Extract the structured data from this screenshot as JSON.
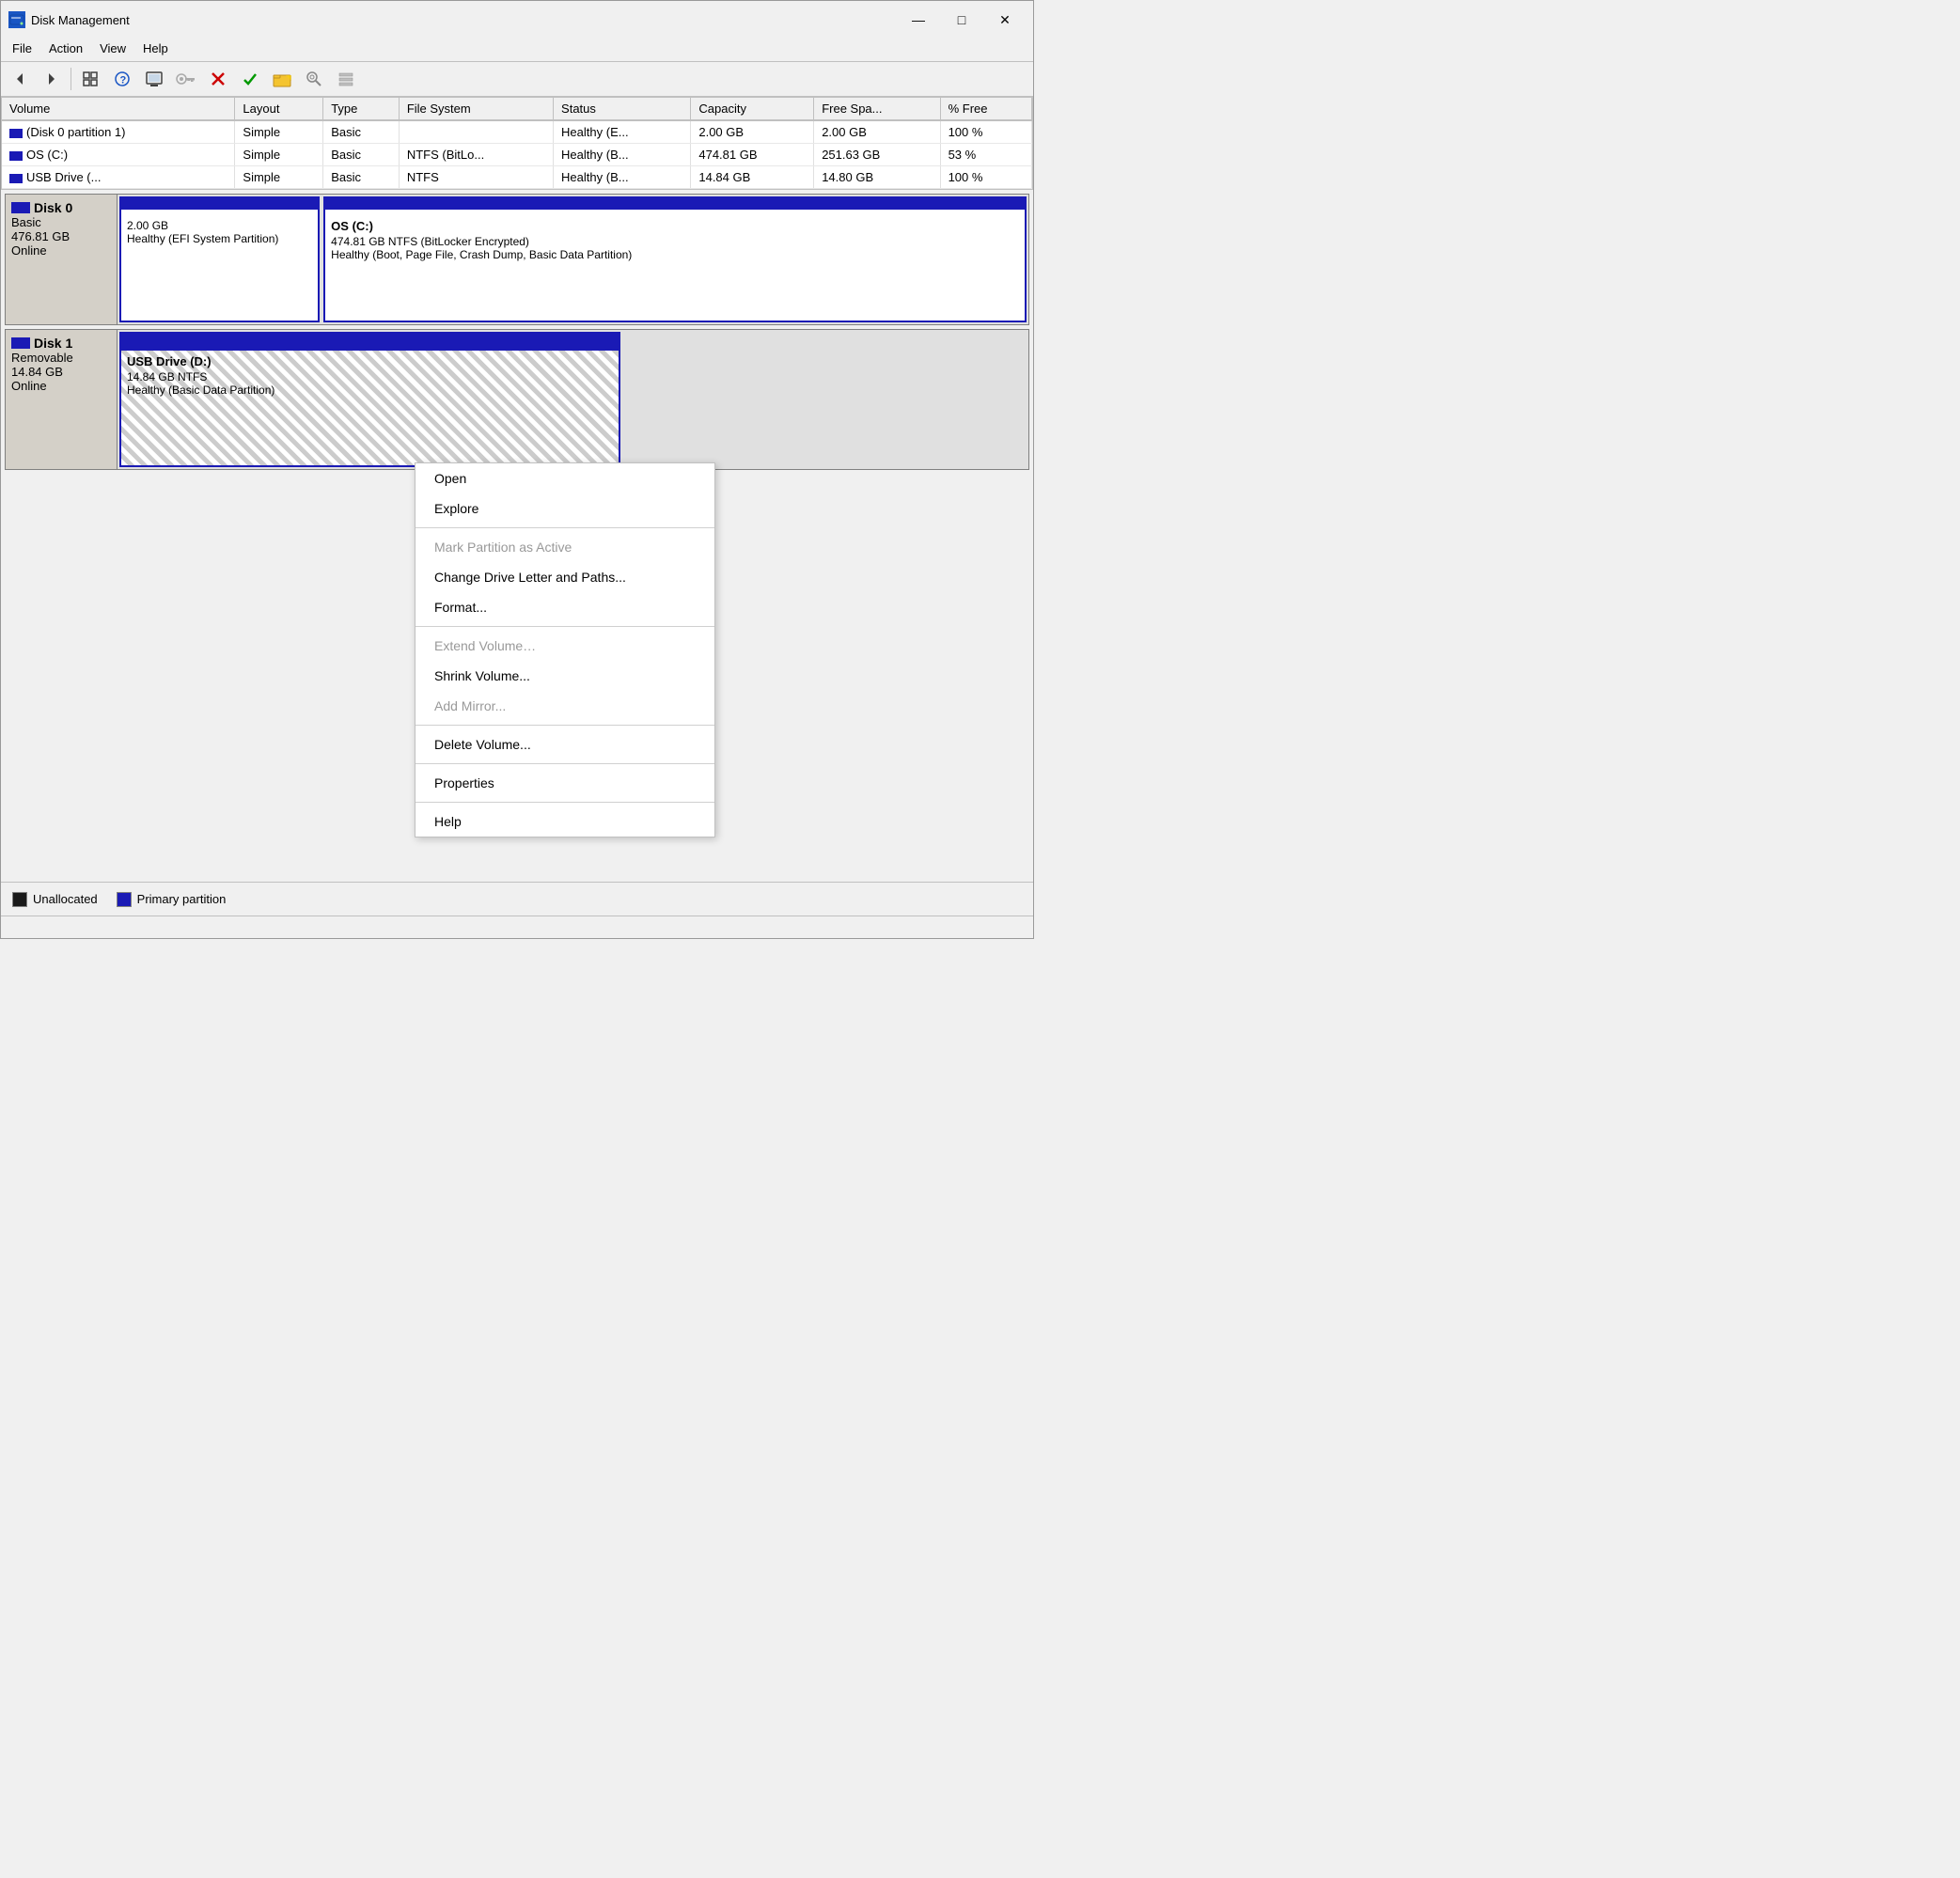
{
  "window": {
    "title": "Disk Management",
    "icon": "disk-icon"
  },
  "titlebar": {
    "minimize": "—",
    "restore": "□",
    "close": "✕"
  },
  "menubar": {
    "items": [
      "File",
      "Action",
      "View",
      "Help"
    ]
  },
  "toolbar": {
    "buttons": [
      "◀",
      "▶",
      "⊞",
      "?",
      "⊡",
      "🔑",
      "✕",
      "✓",
      "📁",
      "🔍",
      "☰"
    ]
  },
  "table": {
    "headers": [
      "Volume",
      "Layout",
      "Type",
      "File System",
      "Status",
      "Capacity",
      "Free Spa...",
      "% Free"
    ],
    "rows": [
      {
        "volume": "(Disk 0 partition 1)",
        "layout": "Simple",
        "type": "Basic",
        "filesystem": "",
        "status": "Healthy (E...",
        "capacity": "2.00 GB",
        "free": "2.00 GB",
        "pct": "100 %"
      },
      {
        "volume": "OS (C:)",
        "layout": "Simple",
        "type": "Basic",
        "filesystem": "NTFS (BitLo...",
        "status": "Healthy (B...",
        "capacity": "474.81 GB",
        "free": "251.63 GB",
        "pct": "53 %"
      },
      {
        "volume": "USB Drive (...",
        "layout": "Simple",
        "type": "Basic",
        "filesystem": "NTFS",
        "status": "Healthy (B...",
        "capacity": "14.84 GB",
        "free": "14.80 GB",
        "pct": "100 %"
      }
    ]
  },
  "disks": [
    {
      "name": "Disk 0",
      "type": "Basic",
      "size": "476.81 GB",
      "status": "Online",
      "partitions": [
        {
          "id": "efi",
          "size": "2.00 GB",
          "status": "Healthy (EFI System Partition)"
        },
        {
          "id": "os",
          "name": "OS  (C:)",
          "size": "474.81 GB NTFS (BitLocker Encrypted)",
          "status": "Healthy (Boot, Page File, Crash Dump, Basic Data Partition)"
        }
      ]
    },
    {
      "name": "Disk 1",
      "type": "Removable",
      "size": "14.84 GB",
      "status": "Online",
      "partitions": [
        {
          "id": "usb",
          "name": "USB Drive  (D:)",
          "size": "14.84 GB NTFS",
          "status": "Healthy (Basic Data Partition)"
        }
      ]
    }
  ],
  "context_menu": {
    "items": [
      {
        "label": "Open",
        "disabled": false
      },
      {
        "label": "Explore",
        "disabled": false
      },
      {
        "separator": true
      },
      {
        "label": "Mark Partition as Active",
        "disabled": true
      },
      {
        "label": "Change Drive Letter and Paths...",
        "disabled": false
      },
      {
        "label": "Format...",
        "disabled": false
      },
      {
        "separator": true
      },
      {
        "label": "Extend Volume…",
        "disabled": true
      },
      {
        "label": "Shrink Volume...",
        "disabled": false
      },
      {
        "label": "Add Mirror...",
        "disabled": true
      },
      {
        "separator": true
      },
      {
        "label": "Delete Volume...",
        "disabled": false
      },
      {
        "separator": true
      },
      {
        "label": "Properties",
        "disabled": false
      },
      {
        "separator": true
      },
      {
        "label": "Help",
        "disabled": false
      }
    ]
  },
  "legend": {
    "unallocated_label": "Unallocated",
    "primary_label": "Primary partition"
  }
}
